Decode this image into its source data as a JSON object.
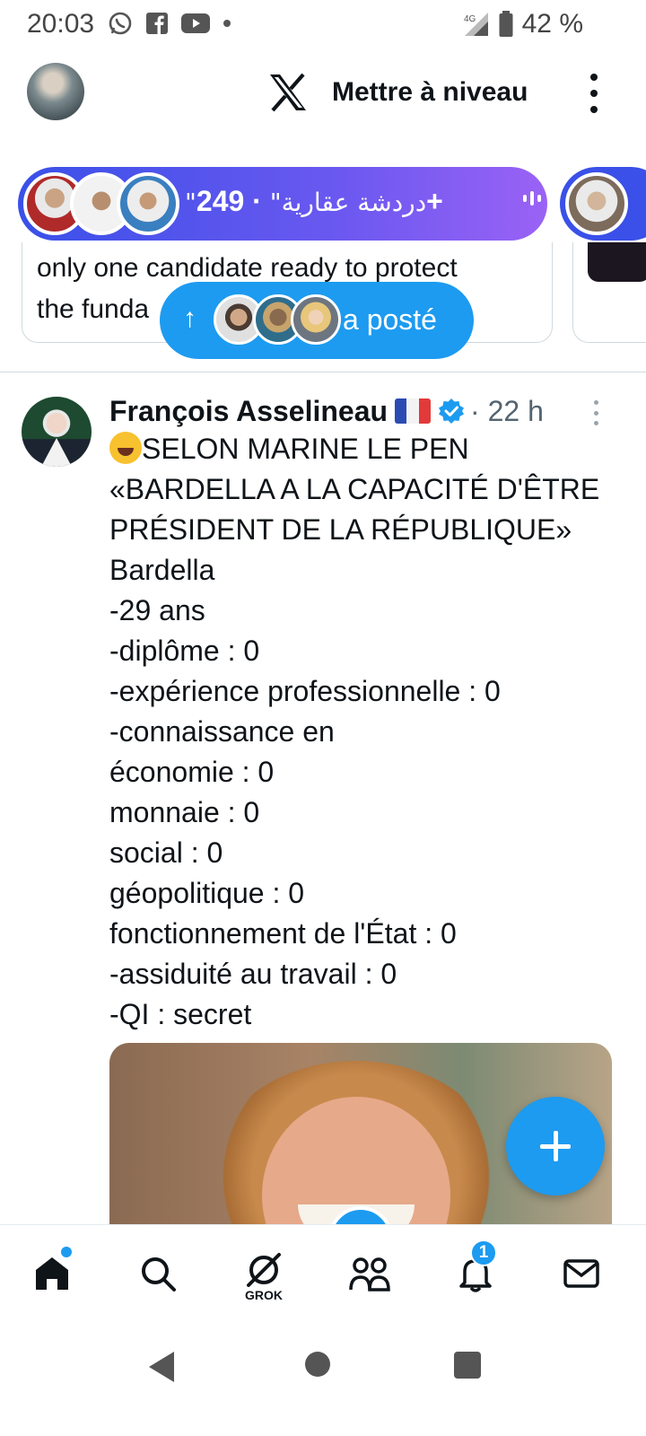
{
  "status_bar": {
    "time": "20:03",
    "network": "4G",
    "battery": "42 %",
    "icons": [
      "whatsapp-icon",
      "facebook-icon",
      "youtube-icon",
      "dot-icon",
      "signal-icon",
      "battery-icon"
    ]
  },
  "header": {
    "upgrade_label": "Mettre à niveau",
    "logo": "x-logo-icon"
  },
  "spaces": {
    "title": "\"دردشة عقارية\"",
    "separator": " · ",
    "count": "249+"
  },
  "previous_post": {
    "line1": "only one candidate ready to protect",
    "line2": "the funda"
  },
  "new_posts_pill": {
    "label": "a posté"
  },
  "tweet": {
    "author": "François Asselineau",
    "time": "· 22 h",
    "lines": [
      "SELON MARINE LE PEN",
      "«BARDELLA A LA CAPACITÉ D'ÊTRE",
      "PRÉSIDENT DE LA RÉPUBLIQUE»",
      "Bardella",
      "-29 ans",
      "-diplôme : 0",
      "-expérience professionnelle : 0",
      "-connaissance en",
      "économie : 0",
      "monnaie : 0",
      "social : 0",
      "géopolitique : 0",
      "fonctionnement de l'État : 0",
      "-assiduité au travail : 0",
      "-QI : secret"
    ]
  },
  "bottom_nav": {
    "grok_label": "GROK",
    "notification_count": "1",
    "items": [
      "home-icon",
      "search-icon",
      "grok-icon",
      "communities-icon",
      "notifications-icon",
      "messages-icon"
    ]
  },
  "colors": {
    "accent": "#1d9bf0",
    "spaces_gradient_start": "#3a50e8",
    "spaces_gradient_end": "#9a62f5"
  }
}
